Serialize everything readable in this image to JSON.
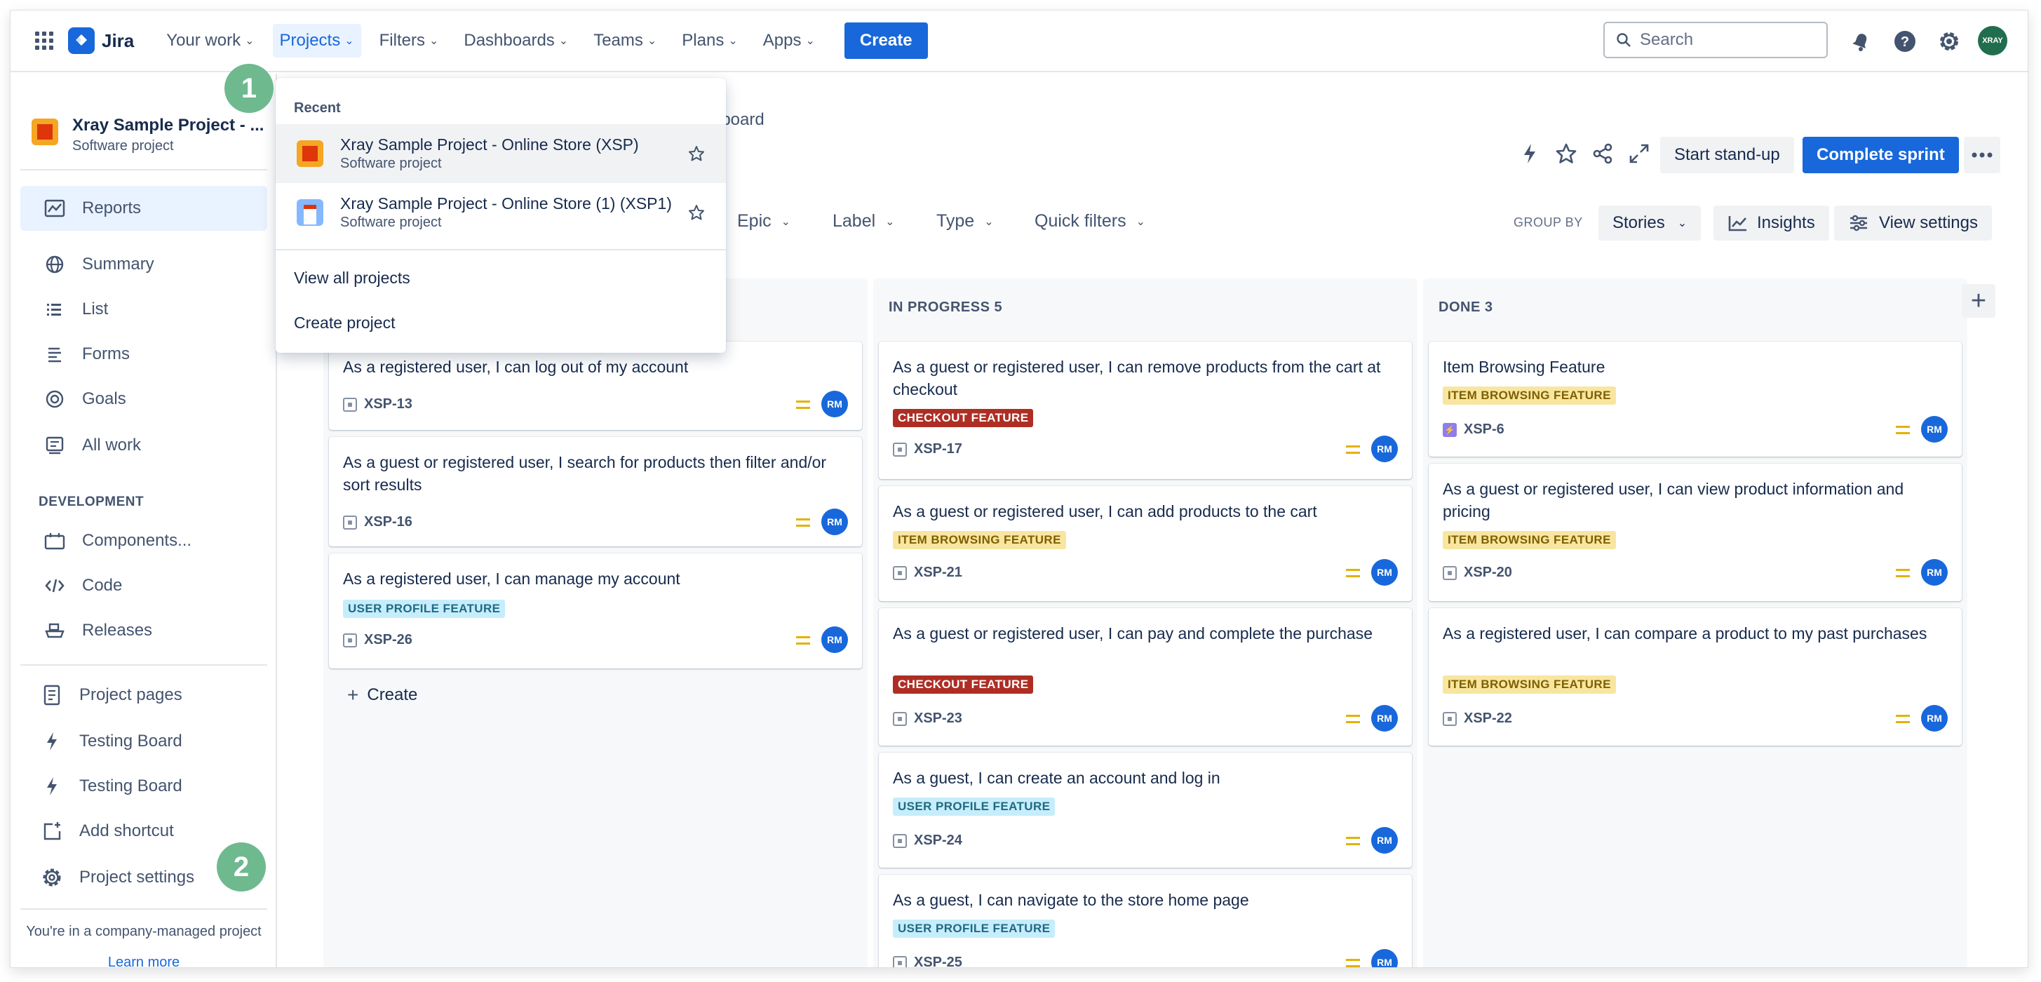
{
  "topnav": {
    "logo": "Jira",
    "items": [
      {
        "label": "Your work"
      },
      {
        "label": "Projects"
      },
      {
        "label": "Filters"
      },
      {
        "label": "Dashboards"
      },
      {
        "label": "Teams"
      },
      {
        "label": "Plans"
      },
      {
        "label": "Apps"
      }
    ],
    "create_label": "Create",
    "search_placeholder": "Search",
    "avatar_text": "XRAY"
  },
  "sidebar": {
    "project_name": "Xray Sample Project - ...",
    "project_type": "Software project",
    "items": [
      {
        "label": "Reports"
      },
      {
        "label": "Summary"
      },
      {
        "label": "List"
      },
      {
        "label": "Forms"
      },
      {
        "label": "Goals"
      },
      {
        "label": "All work"
      }
    ],
    "dev_section": "DEVELOPMENT",
    "dev_items": [
      {
        "label": "Components..."
      },
      {
        "label": "Code"
      },
      {
        "label": "Releases"
      }
    ],
    "bottom_items": [
      {
        "label": "Project pages"
      },
      {
        "label": "Testing Board"
      },
      {
        "label": "Testing Board"
      },
      {
        "label": "Add shortcut"
      },
      {
        "label": "Project settings"
      }
    ],
    "footer_text": "You're in a company-managed project",
    "footer_link": "Learn more"
  },
  "steps": [
    "1",
    "2"
  ],
  "dropdown": {
    "heading": "Recent",
    "recent": [
      {
        "name": "Xray Sample Project - Online Store (XSP)",
        "type": "Software project"
      },
      {
        "name": "Xray Sample Project - Online Store (1) (XSP1)",
        "type": "Software project"
      }
    ],
    "view_all": "View all projects",
    "create_project": "Create project"
  },
  "board": {
    "breadcrumb_tail": "/ board",
    "start_standup": "Start stand-up",
    "complete_sprint": "Complete sprint",
    "filters": [
      "Epic",
      "Label",
      "Type",
      "Quick filters"
    ],
    "group_by_label": "GROUP BY",
    "group_by_value": "Stories",
    "insights": "Insights",
    "view_settings": "View settings",
    "create_inline": "Create",
    "columns": [
      {
        "title": "",
        "cards": [
          {
            "title": "As a registered user, I can log out of my account",
            "label": "",
            "key": "XSP-13",
            "assignee": "RM"
          },
          {
            "title": "As a guest or registered user, I search for products then filter and/or sort results",
            "label": "",
            "key": "XSP-16",
            "assignee": "RM"
          },
          {
            "title": "As a registered user, I can manage my account",
            "label": "USER PROFILE FEATURE",
            "key": "XSP-26",
            "assignee": "RM"
          }
        ]
      },
      {
        "title": "IN PROGRESS 5",
        "cards": [
          {
            "title": "As a guest or registered user, I can remove products from the cart at checkout",
            "label": "CHECKOUT FEATURE",
            "key": "XSP-17",
            "assignee": "RM"
          },
          {
            "title": "As a guest or registered user, I can add products to the cart",
            "label": "ITEM BROWSING FEATURE",
            "key": "XSP-21",
            "assignee": "RM"
          },
          {
            "title": "As a guest or registered user, I can pay and complete the purchase",
            "label": "CHECKOUT FEATURE",
            "key": "XSP-23",
            "assignee": "RM"
          },
          {
            "title": "As a guest, I can create an account and log in",
            "label": "USER PROFILE FEATURE",
            "key": "XSP-24",
            "assignee": "RM"
          },
          {
            "title": "As a guest, I can navigate to the store home page",
            "label": "USER PROFILE FEATURE",
            "key": "XSP-25",
            "assignee": "RM"
          }
        ]
      },
      {
        "title": "DONE 3",
        "cards": [
          {
            "title": "Item Browsing Feature",
            "label": "ITEM BROWSING FEATURE",
            "key": "XSP-6",
            "assignee": "RM"
          },
          {
            "title": "As a guest or registered user, I can view product information and pricing",
            "label": "ITEM BROWSING FEATURE",
            "key": "XSP-20",
            "assignee": "RM"
          },
          {
            "title": "As a registered user, I can compare a product to my past purchases",
            "label": "ITEM BROWSING FEATURE",
            "key": "XSP-22",
            "assignee": "RM"
          }
        ]
      }
    ]
  },
  "colors": {
    "brand_blue": "#1868db",
    "step_badge": "#6fb98f",
    "checkout_label": "#ae2e24",
    "item_browsing_label": "#f8e6a0",
    "user_profile_label": "#c6edfb"
  }
}
